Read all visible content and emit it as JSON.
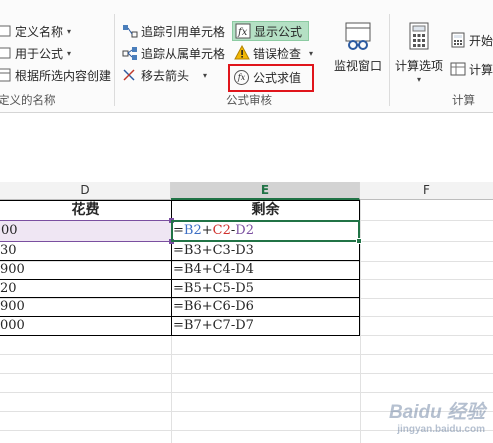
{
  "ribbon": {
    "defined_names": {
      "define_name": "定义名称",
      "use_in_formula": "用于公式",
      "create_from_selection": "根据所选内容创建",
      "group_label": "定义的名称"
    },
    "formula_auditing": {
      "trace_precedents": "追踪引用单元格",
      "trace_dependents": "追踪从属单元格",
      "remove_arrows": "移去箭头",
      "show_formulas": "显示公式",
      "error_checking": "错误检查",
      "evaluate_formula": "公式求值",
      "watch_window": "监视窗口",
      "group_label": "公式审核"
    },
    "calculation": {
      "calc_options": "计算选项",
      "calc_now": "开始",
      "calc_sheet": "计算",
      "group_label": "计算"
    }
  },
  "grid": {
    "columns": [
      "D",
      "E",
      "F"
    ],
    "selected_column": "E",
    "headers": {
      "d": "花费",
      "e": "剩余"
    },
    "rows": [
      {
        "d": "00",
        "e_parts": [
          "=",
          "B2",
          "+",
          "C2",
          "-",
          "D2"
        ]
      },
      {
        "d": "30",
        "e": "=B3+C3-D3"
      },
      {
        "d": "900",
        "e": "=B4+C4-D4"
      },
      {
        "d": "20",
        "e": "=B5+C5-D5"
      },
      {
        "d": "900",
        "e": "=B6+C6-D6"
      },
      {
        "d": "000",
        "e": "=B7+C7-D7"
      }
    ],
    "ref_colors": {
      "b": "#3d6fc4",
      "c": "#d0312d",
      "d": "#7a4fa0"
    }
  },
  "watermark": {
    "brand": "Baidu 经验",
    "url": "jingyan.baidu.com"
  },
  "colors": {
    "accent": "#217346",
    "highlight": "#b4e0c4",
    "callout": "#e0151b"
  }
}
